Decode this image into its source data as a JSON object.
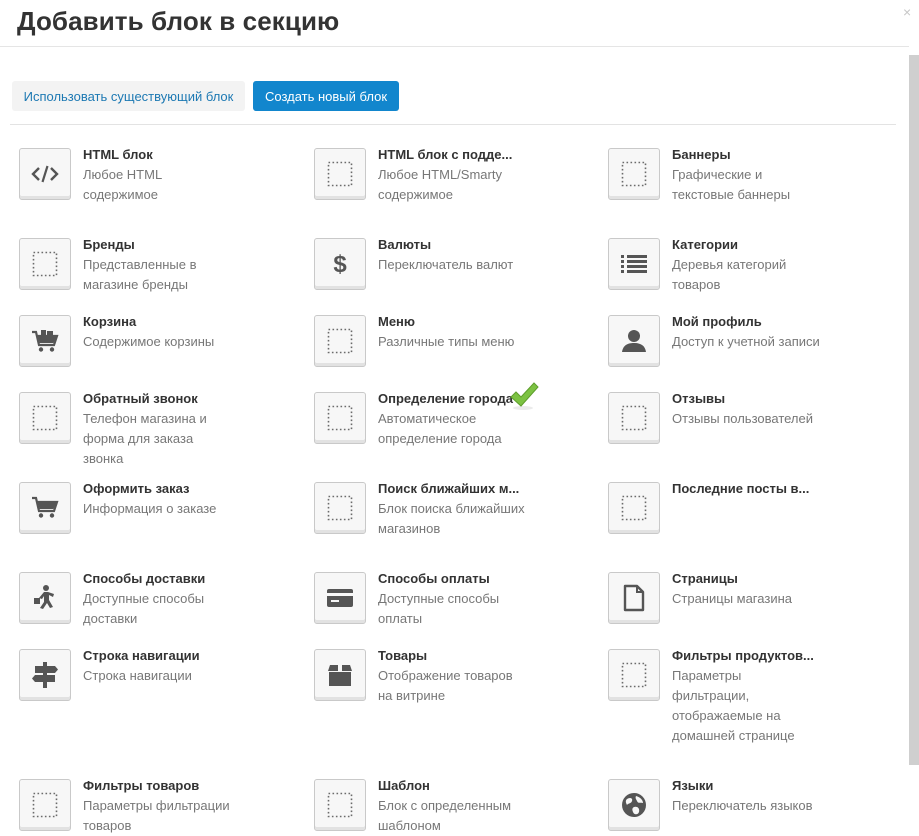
{
  "dialog": {
    "title": "Добавить блок в секцию",
    "close_glyph": "×"
  },
  "tabs": {
    "existing_label": "Использовать существующий блок",
    "create_label": "Создать новый блок"
  },
  "colors": {
    "accent": "#1286cd",
    "link": "#1d79b3",
    "check": "#7cc242"
  },
  "blocks": [
    {
      "name": "HTML блок",
      "desc": "Любое HTML содержимое",
      "icon": "code-icon"
    },
    {
      "name": "HTML блок с подде...",
      "desc": "Любое HTML/Smarty содержимое",
      "icon": "dotted-square-icon"
    },
    {
      "name": "Баннеры",
      "desc": "Графические и текстовые баннеры",
      "icon": "dotted-square-icon"
    },
    {
      "name": "Бренды",
      "desc": "Представленные в магазине бренды",
      "icon": "dotted-square-icon"
    },
    {
      "name": "Валюты",
      "desc": "Переключатель валют",
      "icon": "dollar-icon"
    },
    {
      "name": "Категории",
      "desc": "Деревья категорий товаров",
      "icon": "list-icon"
    },
    {
      "name": "Корзина",
      "desc": "Содержимое корзины",
      "icon": "cart-full-icon"
    },
    {
      "name": "Меню",
      "desc": "Различные типы меню",
      "icon": "dotted-square-icon"
    },
    {
      "name": "Мой профиль",
      "desc": "Доступ к учетной записи",
      "icon": "user-icon"
    },
    {
      "name": "Обратный звонок",
      "desc": "Телефон магазина и форма для заказа звонка",
      "icon": "dotted-square-icon"
    },
    {
      "name": "Определение города",
      "desc": "Автоматическое определение города",
      "icon": "dotted-square-icon",
      "selected": true
    },
    {
      "name": "Отзывы",
      "desc": "Отзывы пользователей",
      "icon": "dotted-square-icon"
    },
    {
      "name": "Оформить заказ",
      "desc": "Информация о заказе",
      "icon": "cart-icon"
    },
    {
      "name": "Поиск ближайших м...",
      "desc": "Блок поиска ближайших магазинов",
      "icon": "dotted-square-icon"
    },
    {
      "name": "Последние посты в...",
      "desc": "",
      "icon": "dotted-square-icon"
    },
    {
      "name": "Способы доставки",
      "desc": "Доступные способы доставки",
      "icon": "courier-icon"
    },
    {
      "name": "Способы оплаты",
      "desc": "Доступные способы оплаты",
      "icon": "credit-card-icon"
    },
    {
      "name": "Страницы",
      "desc": "Страницы магазина",
      "icon": "page-icon"
    },
    {
      "name": "Строка навигации",
      "desc": "Строка навигации",
      "icon": "signpost-icon"
    },
    {
      "name": "Товары",
      "desc": "Отображение товаров на витрине",
      "icon": "box-icon"
    },
    {
      "name": "Фильтры продуктов...",
      "desc": "Параметры фильтрации, отображаемые на домашней странице",
      "icon": "dotted-square-icon"
    },
    {
      "name": "Фильтры товаров",
      "desc": "Параметры фильтрации товаров",
      "icon": "dotted-square-icon"
    },
    {
      "name": "Шаблон",
      "desc": "Блок с определенным шаблоном",
      "icon": "dotted-square-icon"
    },
    {
      "name": "Языки",
      "desc": "Переключатель языков",
      "icon": "globe-icon"
    }
  ]
}
